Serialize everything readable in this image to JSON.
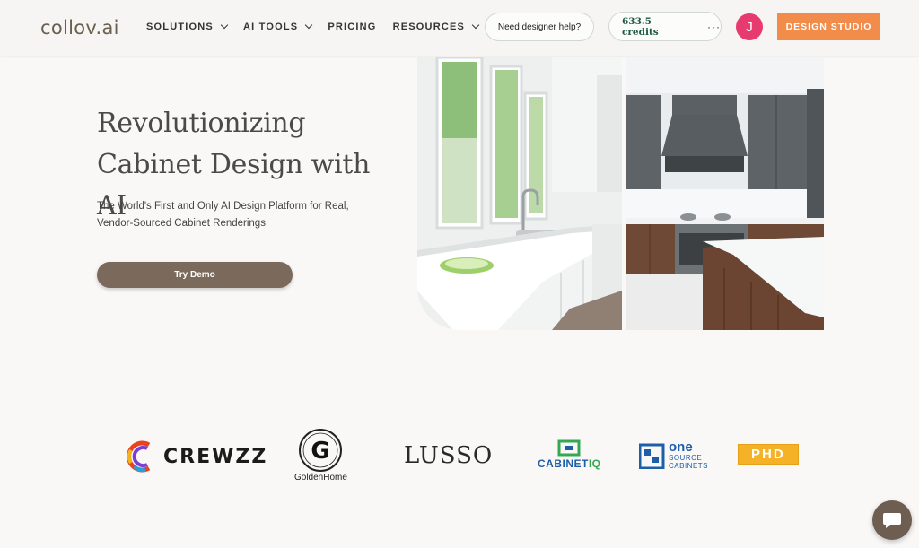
{
  "header": {
    "logo": "collov.ai",
    "nav": [
      {
        "label": "SOLUTIONS",
        "dropdown": true
      },
      {
        "label": "AI TOOLS",
        "dropdown": true
      },
      {
        "label": "PRICING",
        "dropdown": false
      },
      {
        "label": "RESOURCES",
        "dropdown": true
      }
    ],
    "help_label": "Need designer help?",
    "credits_label": "633.5 credits",
    "more_label": "···",
    "avatar_initial": "J",
    "studio_label": "DESIGN STUDIO"
  },
  "hero": {
    "title_line1": "Revolutionizing",
    "title_line2": "Cabinet Design with AI",
    "subtitle_line1": "The World's First and Only AI Design Platform for Real,",
    "subtitle_line2": "Vendor-Sourced Cabinet Renderings",
    "demo_label": "Try Demo"
  },
  "partners": {
    "crewzz": "CREWZZ",
    "golden_home": "GoldenHome",
    "lusso": "LUSSO",
    "cabinet_iq_main": "CABINET",
    "cabinet_iq_accent": "IQ",
    "one_source_one": "one",
    "one_source_sub1": "SOURCE",
    "one_source_sub2": "CABINETS",
    "phd": "PHD"
  },
  "colors": {
    "accent_orange": "#f28c4a",
    "button_brown": "#7b6a5b",
    "avatar_pink": "#e73a6f",
    "credits_green": "#1f5a45"
  }
}
